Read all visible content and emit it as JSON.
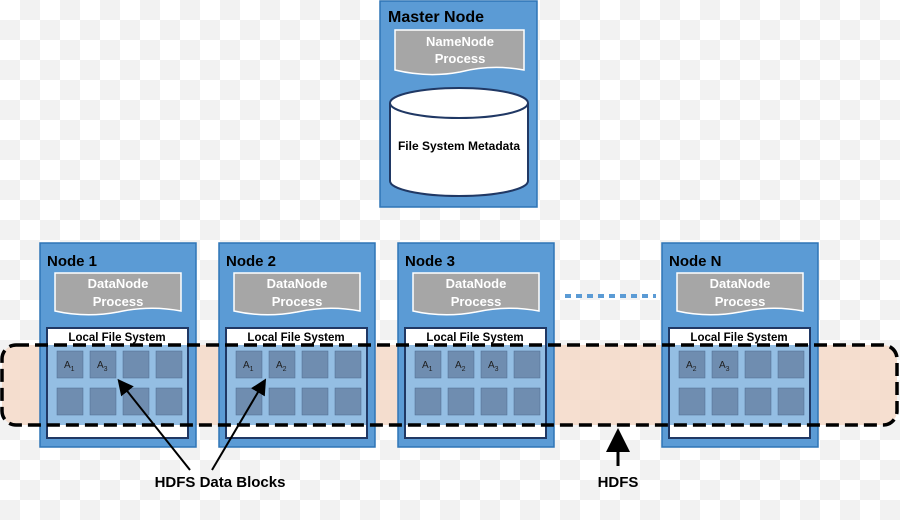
{
  "colors": {
    "node": "#5b9bd5",
    "node_border": "#2e75b6",
    "process": "#a6a6a6",
    "block": "#6f8db0",
    "lfs_border": "#203864",
    "hdfs_fill": "#f4d9c8"
  },
  "master": {
    "title": "Master Node",
    "process": "NameNode Process",
    "process_lines": [
      "NameNode",
      "Process"
    ],
    "metadata": "File System Metadata"
  },
  "nodes": [
    {
      "title": "Node 1",
      "process_lines": [
        "DataNode",
        "Process"
      ],
      "lfs": "Local File System",
      "blocks": [
        [
          "1"
        ],
        [
          "3"
        ]
      ]
    },
    {
      "title": "Node 2",
      "process_lines": [
        "DataNode",
        "Process"
      ],
      "lfs": "Local File System",
      "blocks": [
        [
          "1"
        ],
        [
          "2"
        ]
      ]
    },
    {
      "title": "Node 3",
      "process_lines": [
        "DataNode",
        "Process"
      ],
      "lfs": "Local File System",
      "blocks": [
        [
          "1"
        ],
        [
          "2"
        ],
        [
          "3"
        ]
      ]
    },
    {
      "title": "Node N",
      "process_lines": [
        "DataNode",
        "Process"
      ],
      "lfs": "Local File System",
      "blocks": [
        [
          "2"
        ],
        [
          "3"
        ]
      ]
    }
  ],
  "block_letter": "A",
  "labels": {
    "data_blocks": "HDFS Data Blocks",
    "hdfs": "HDFS"
  }
}
